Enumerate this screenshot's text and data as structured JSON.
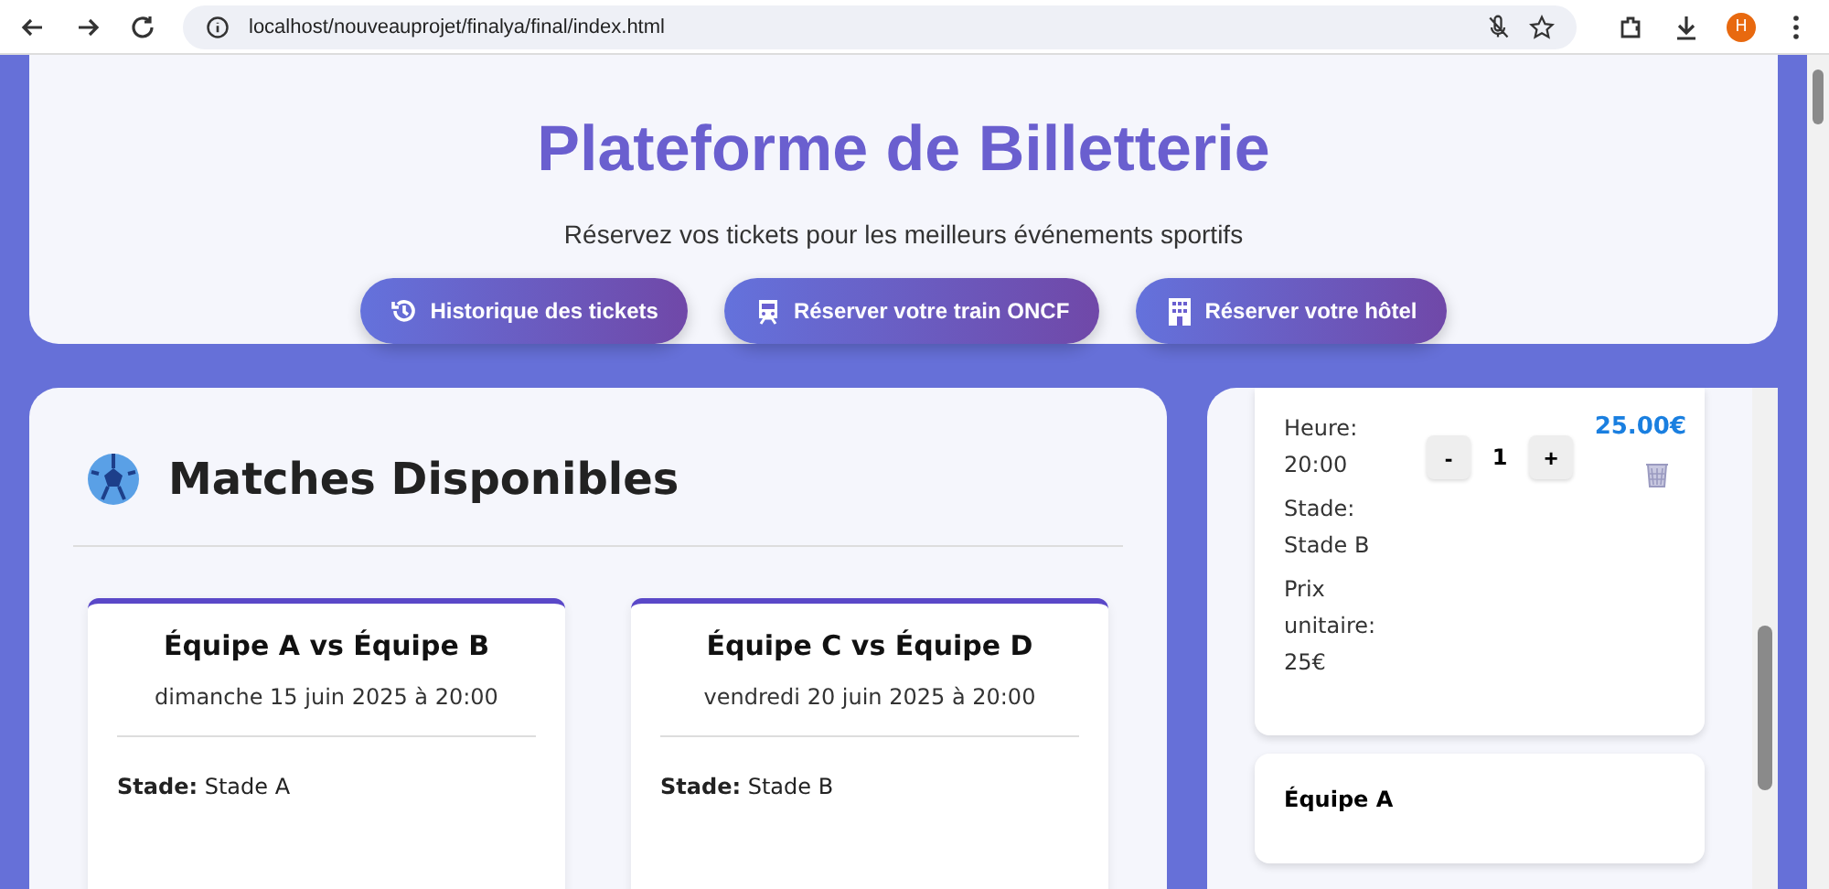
{
  "browser": {
    "url": "localhost/nouveauprojet/finalya/final/index.html",
    "profile_initial": "H"
  },
  "header": {
    "title": "Plateforme de Billetterie",
    "subtitle": "Réservez vos tickets pour les meilleurs événements sportifs",
    "buttons": [
      {
        "label": "Historique des tickets",
        "kind": "history"
      },
      {
        "label": "Réserver votre train ONCF",
        "kind": "train"
      },
      {
        "label": "Réserver votre hôtel",
        "kind": "hotel"
      }
    ]
  },
  "matches": {
    "title": "Matches Disponibles",
    "cards": [
      {
        "title": "Équipe A vs Équipe B",
        "date": "dimanche 15 juin 2025 à 20:00",
        "stade_label": "Stade:",
        "stade": "Stade A"
      },
      {
        "title": "Équipe C vs Équipe D",
        "date": "vendredi 20 juin 2025 à 20:00",
        "stade_label": "Stade:",
        "stade": "Stade B"
      }
    ]
  },
  "cart": {
    "item": {
      "heure_label": "Heure:",
      "heure": "20:00",
      "stade_label": "Stade:",
      "stade": "Stade B",
      "prix_label": "Prix unitaire:",
      "prix": "25€",
      "minus": "-",
      "quantity": "1",
      "plus": "+",
      "total": "25.00€"
    },
    "next_item_title": "Équipe A"
  }
}
